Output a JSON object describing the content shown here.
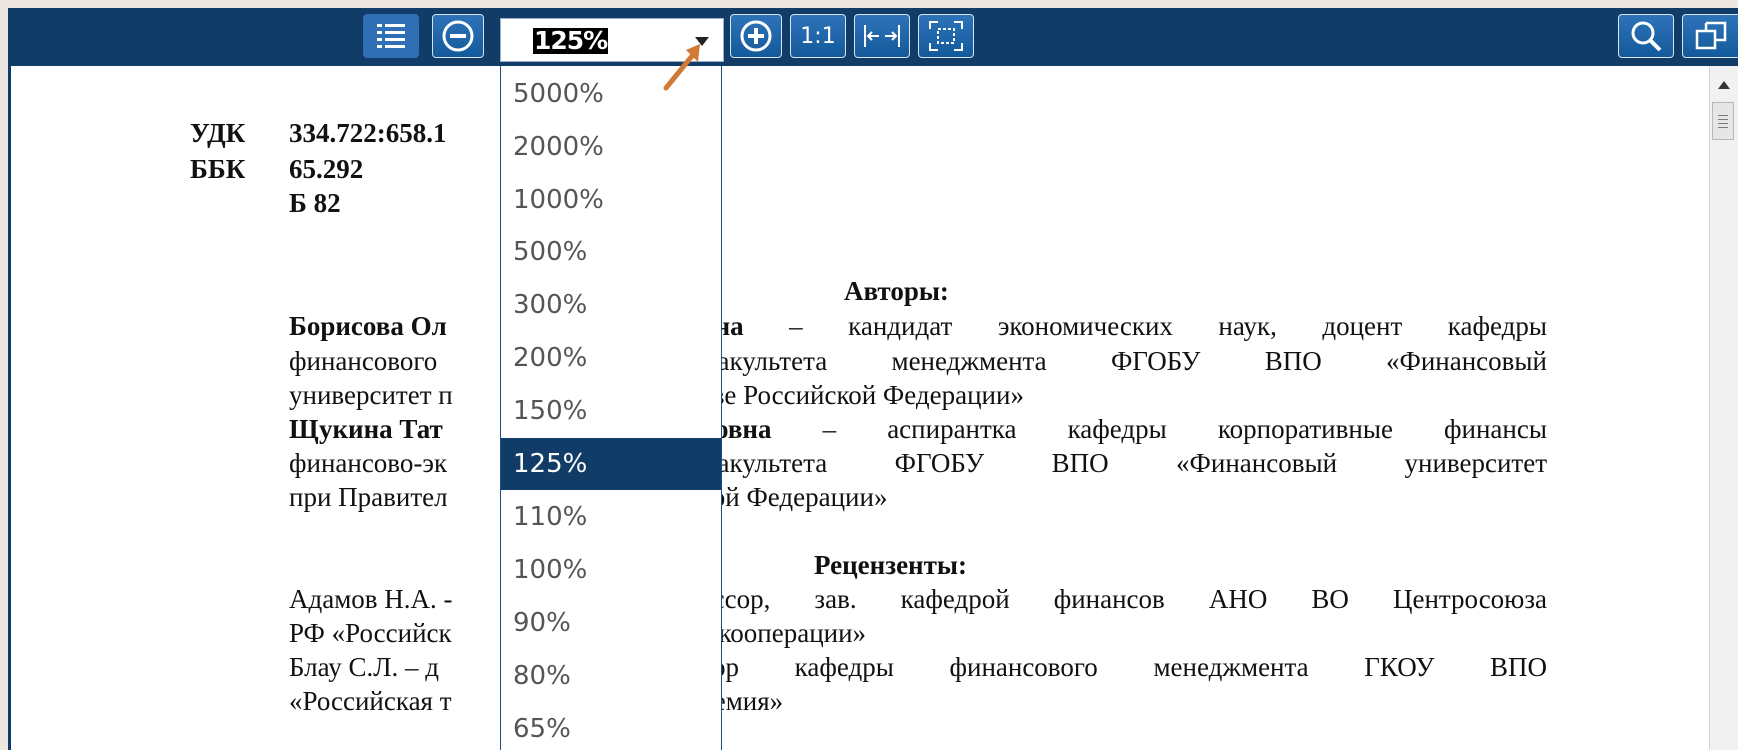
{
  "toolbar": {
    "zoom_value": "125%",
    "actual_size_label": "1:1",
    "buttons": [
      "toc",
      "zoom-out",
      "zoom-in",
      "actual-size",
      "fit-width",
      "fit-page",
      "search",
      "popout"
    ],
    "colors": {
      "bar": "#123c68",
      "button": "#1f68ad",
      "highlight": "#123c68"
    }
  },
  "zoom_options": [
    "5000%",
    "2000%",
    "1000%",
    "500%",
    "300%",
    "200%",
    "150%",
    "125%",
    "110%",
    "100%",
    "90%",
    "80%",
    "65%"
  ],
  "selected_zoom": "125%",
  "document": {
    "udk_label": "УДК",
    "udk_value": "334.722:658.1",
    "bbk_label": "ББК",
    "bbk_value": "65.292",
    "code": "Б 82",
    "authors_heading": "Авторы:",
    "author1_name": "Борисова Ол",
    "author1_rest": "вна – кандидат экономических наук, доцент кафедры",
    "author1_line2_left": "финансового",
    "author1_line2_right": "факультета менеджмента ФГОБУ ВПО «Финансовый",
    "author1_line3_left": "университет п",
    "author1_line3_right": "тве Российской Федерации»",
    "author2_name": "Щукина Тат",
    "author2_rest": "ровна – аспирантка кафедры корпоративные финансы",
    "author2_line2_left": "финансово-эк",
    "author2_line2_right": "факультета ФГОБУ ВПО «Финансовый университет",
    "author2_line3_left": "при Правител",
    "author2_line3_right": "кой Федерации»",
    "reviewers_heading": "Рецензенты:",
    "rev1_left": "Адамов Н.А. -",
    "rev1_right": "ессор, зав. кафедрой финансов АНО ВО Центросоюза",
    "rev1_line2_left": "РФ «Российск",
    "rev1_line2_right": "т кооперации»",
    "rev2_left": "Блау С.Л. – д",
    "rev2_right": "сор кафедры финансового менеджмента ГКОУ ВПО",
    "rev2_line2_left": "«Российская т",
    "rev2_line2_right": "демия»"
  }
}
